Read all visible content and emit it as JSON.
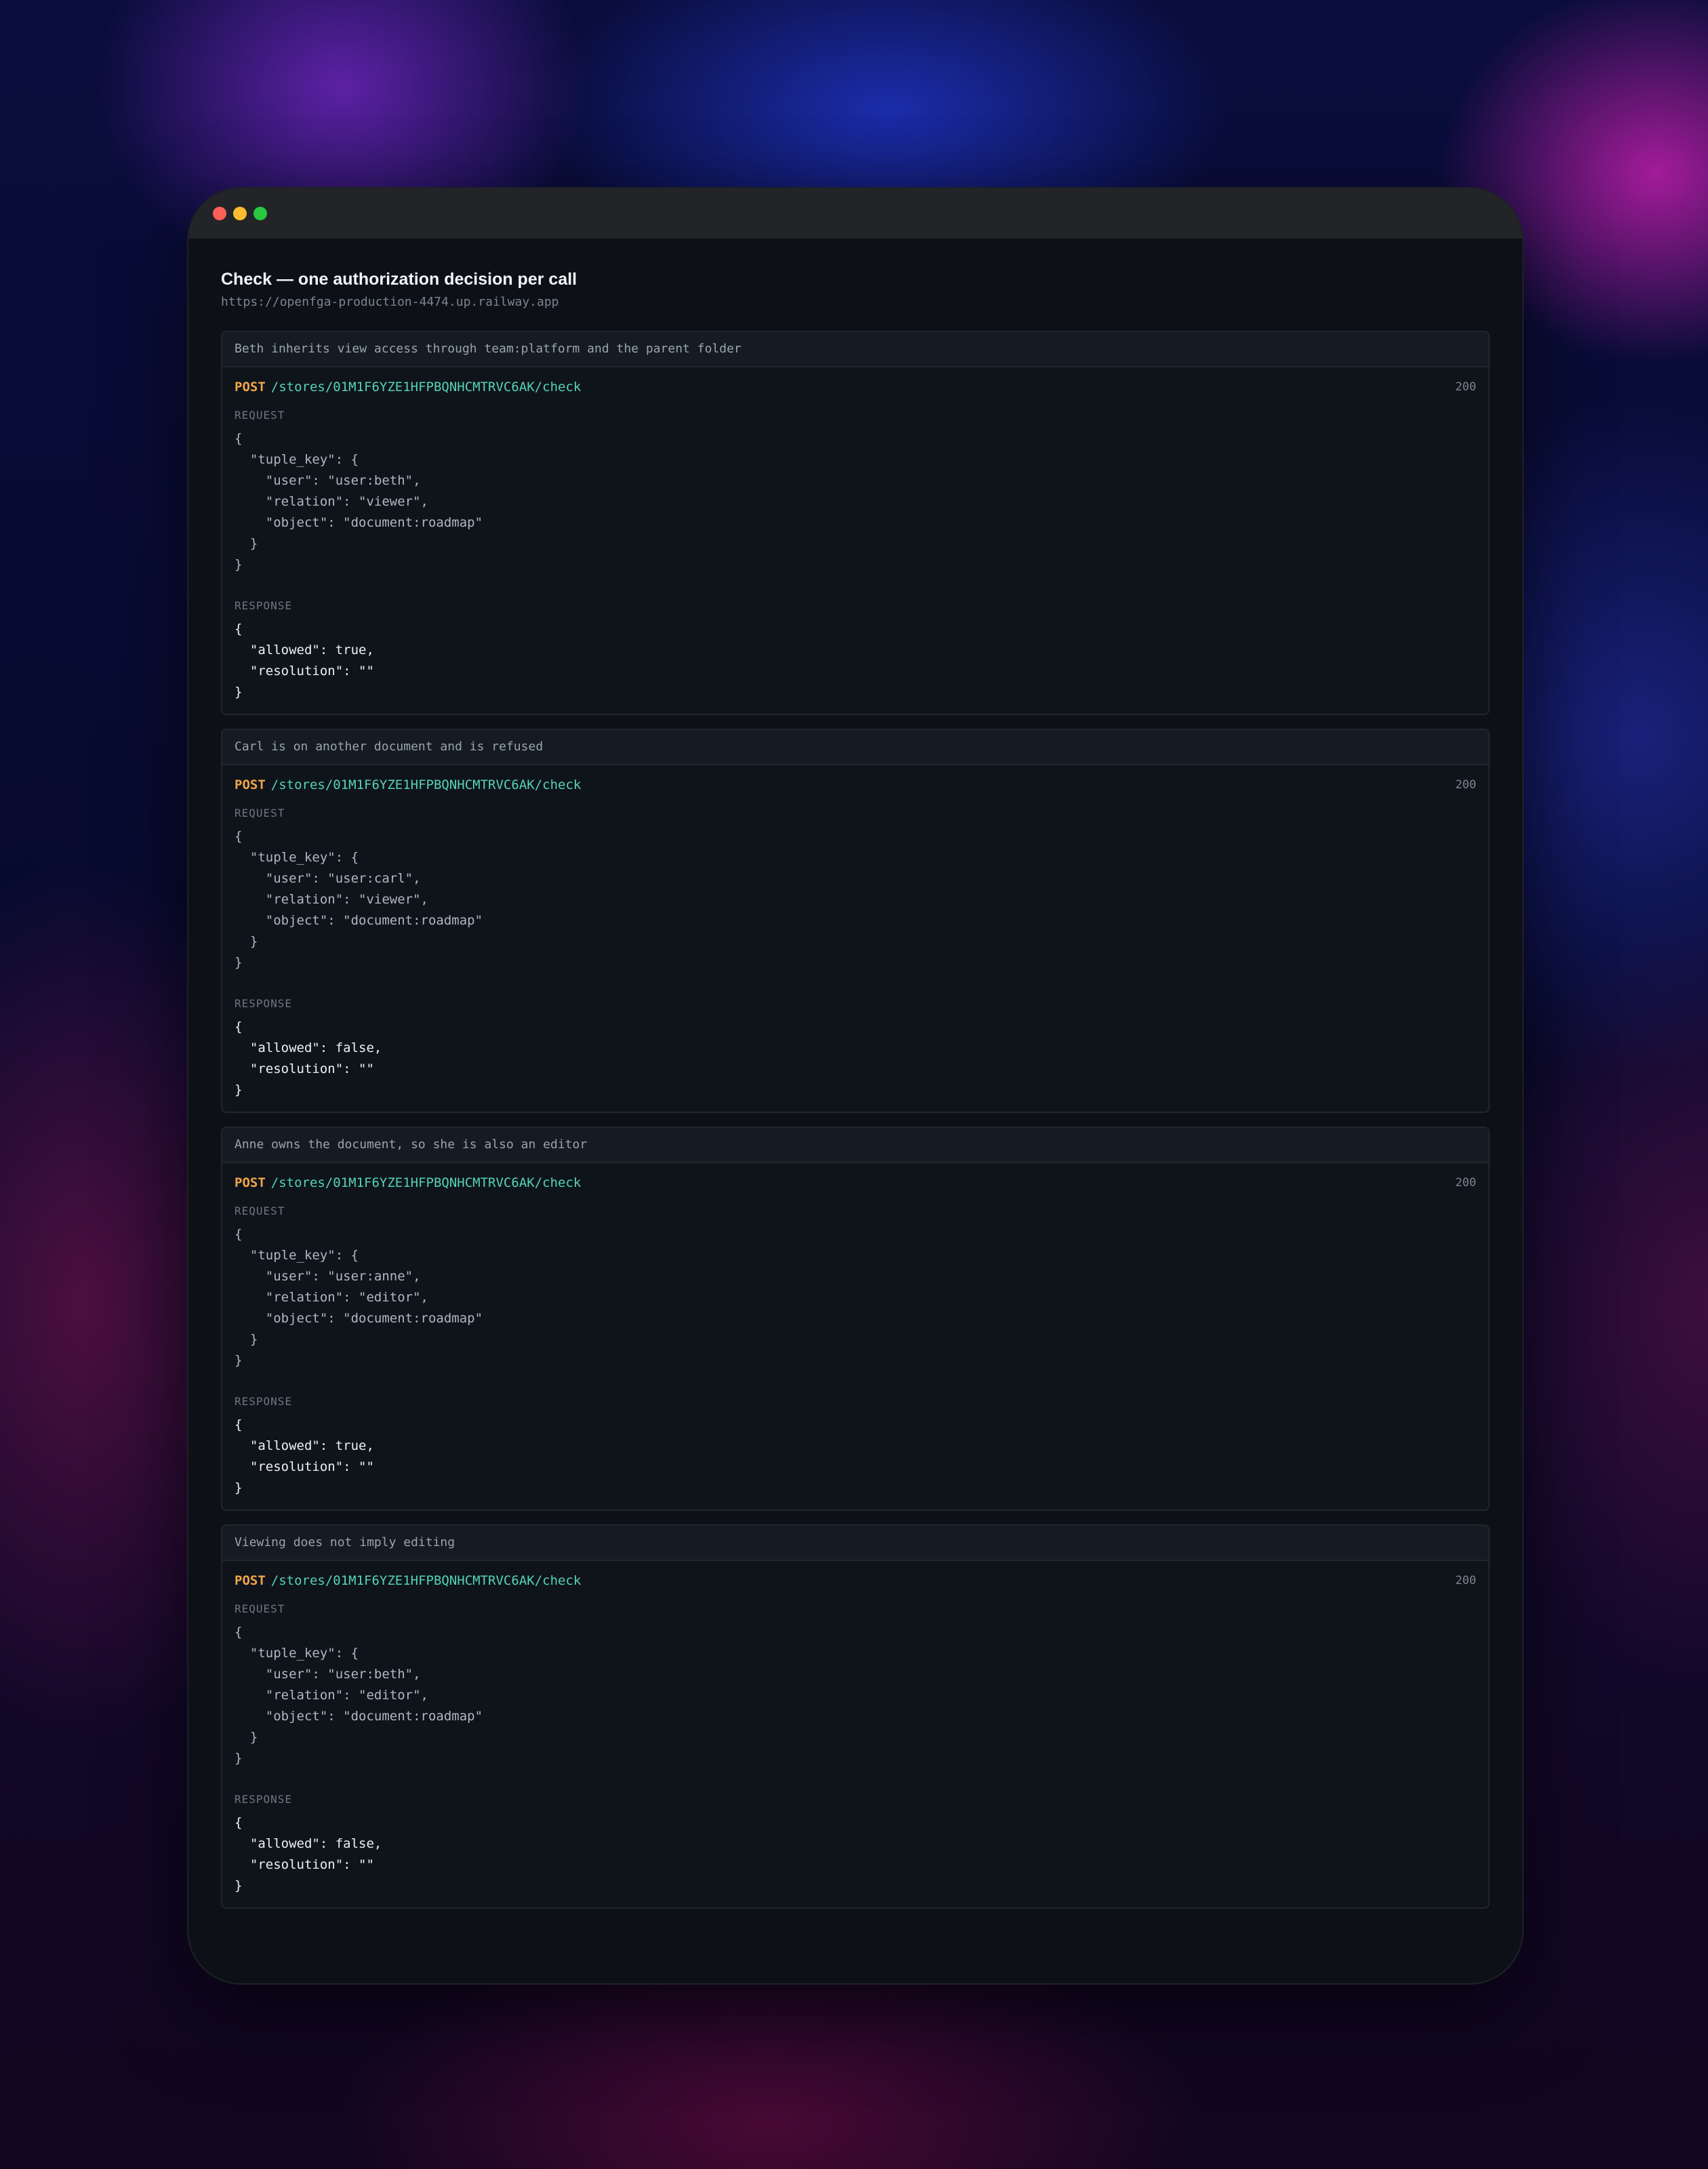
{
  "header": {
    "title": "Check — one authorization decision per call",
    "url": "https://openfga-production-4474.up.railway.app"
  },
  "labels": {
    "request": "REQUEST",
    "response": "RESPONSE"
  },
  "colors": {
    "method": "#f0a54a",
    "path": "#56d3b5",
    "window_bg": "#0d1117",
    "titlebar_bg": "#222428",
    "dot_close": "#ff5f57",
    "dot_minimize": "#febc2e",
    "dot_maximize": "#28c840"
  },
  "window_controls": [
    "close-dot",
    "minimize-dot",
    "maximize-dot"
  ],
  "cards": [
    {
      "description": "Beth inherits view access through team:platform and the parent folder",
      "method": "POST",
      "path": "/stores/01M1F6YZE1HFPBQNHCMTRVC6AK/check",
      "status": "200",
      "request": "{\n  \"tuple_key\": {\n    \"user\": \"user:beth\",\n    \"relation\": \"viewer\",\n    \"object\": \"document:roadmap\"\n  }\n}",
      "response": "{\n  \"allowed\": true,\n  \"resolution\": \"\"\n}"
    },
    {
      "description": "Carl is on another document and is refused",
      "method": "POST",
      "path": "/stores/01M1F6YZE1HFPBQNHCMTRVC6AK/check",
      "status": "200",
      "request": "{\n  \"tuple_key\": {\n    \"user\": \"user:carl\",\n    \"relation\": \"viewer\",\n    \"object\": \"document:roadmap\"\n  }\n}",
      "response": "{\n  \"allowed\": false,\n  \"resolution\": \"\"\n}"
    },
    {
      "description": "Anne owns the document, so she is also an editor",
      "method": "POST",
      "path": "/stores/01M1F6YZE1HFPBQNHCMTRVC6AK/check",
      "status": "200",
      "request": "{\n  \"tuple_key\": {\n    \"user\": \"user:anne\",\n    \"relation\": \"editor\",\n    \"object\": \"document:roadmap\"\n  }\n}",
      "response": "{\n  \"allowed\": true,\n  \"resolution\": \"\"\n}"
    },
    {
      "description": "Viewing does not imply editing",
      "method": "POST",
      "path": "/stores/01M1F6YZE1HFPBQNHCMTRVC6AK/check",
      "status": "200",
      "request": "{\n  \"tuple_key\": {\n    \"user\": \"user:beth\",\n    \"relation\": \"editor\",\n    \"object\": \"document:roadmap\"\n  }\n}",
      "response": "{\n  \"allowed\": false,\n  \"resolution\": \"\"\n}"
    }
  ]
}
